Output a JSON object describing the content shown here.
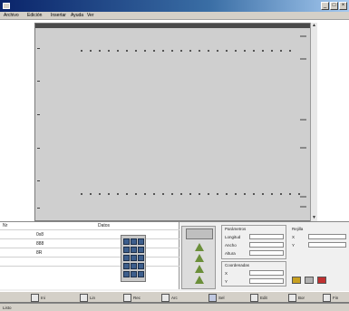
{
  "window": {
    "title": ""
  },
  "menu": [
    {
      "label": "Archivo"
    },
    {
      "label": "Edición"
    },
    {
      "label": "Insertar"
    },
    {
      "label": "Ayuda"
    },
    {
      "label": "Ver"
    }
  ],
  "table": {
    "headers": [
      "Nr",
      "Datos"
    ],
    "rows": [
      {
        "c1": "",
        "c2": "0x8"
      },
      {
        "c1": "",
        "c2": "888"
      },
      {
        "c1": "",
        "c2": "8R"
      },
      {
        "c1": "",
        "c2": ""
      },
      {
        "c1": "",
        "c2": ""
      }
    ]
  },
  "params": {
    "group1": "Parámetros",
    "lbl_a": "Longitud",
    "lbl_b": "Ancho",
    "lbl_c": "Altura",
    "group2": "Coordenadas",
    "lbl_d": "X",
    "lbl_e": "Y"
  },
  "coords": {
    "title": "Rejilla",
    "lbl_x": "X",
    "lbl_y": "Y"
  },
  "toolbar": [
    {
      "label": "Ini"
    },
    {
      "label": "Lin"
    },
    {
      "label": "Rec"
    },
    {
      "label": "Arc"
    },
    {
      "label": "Sel"
    },
    {
      "label": "Edit"
    },
    {
      "label": "Bor"
    },
    {
      "label": "Fin"
    }
  ],
  "status": {
    "text": "Listo"
  },
  "colors": {
    "title_start": "#0a246a",
    "canvas": "#cfcfcf",
    "accent_green": "#6b8f3a",
    "key_blue": "#3d5e8c"
  }
}
